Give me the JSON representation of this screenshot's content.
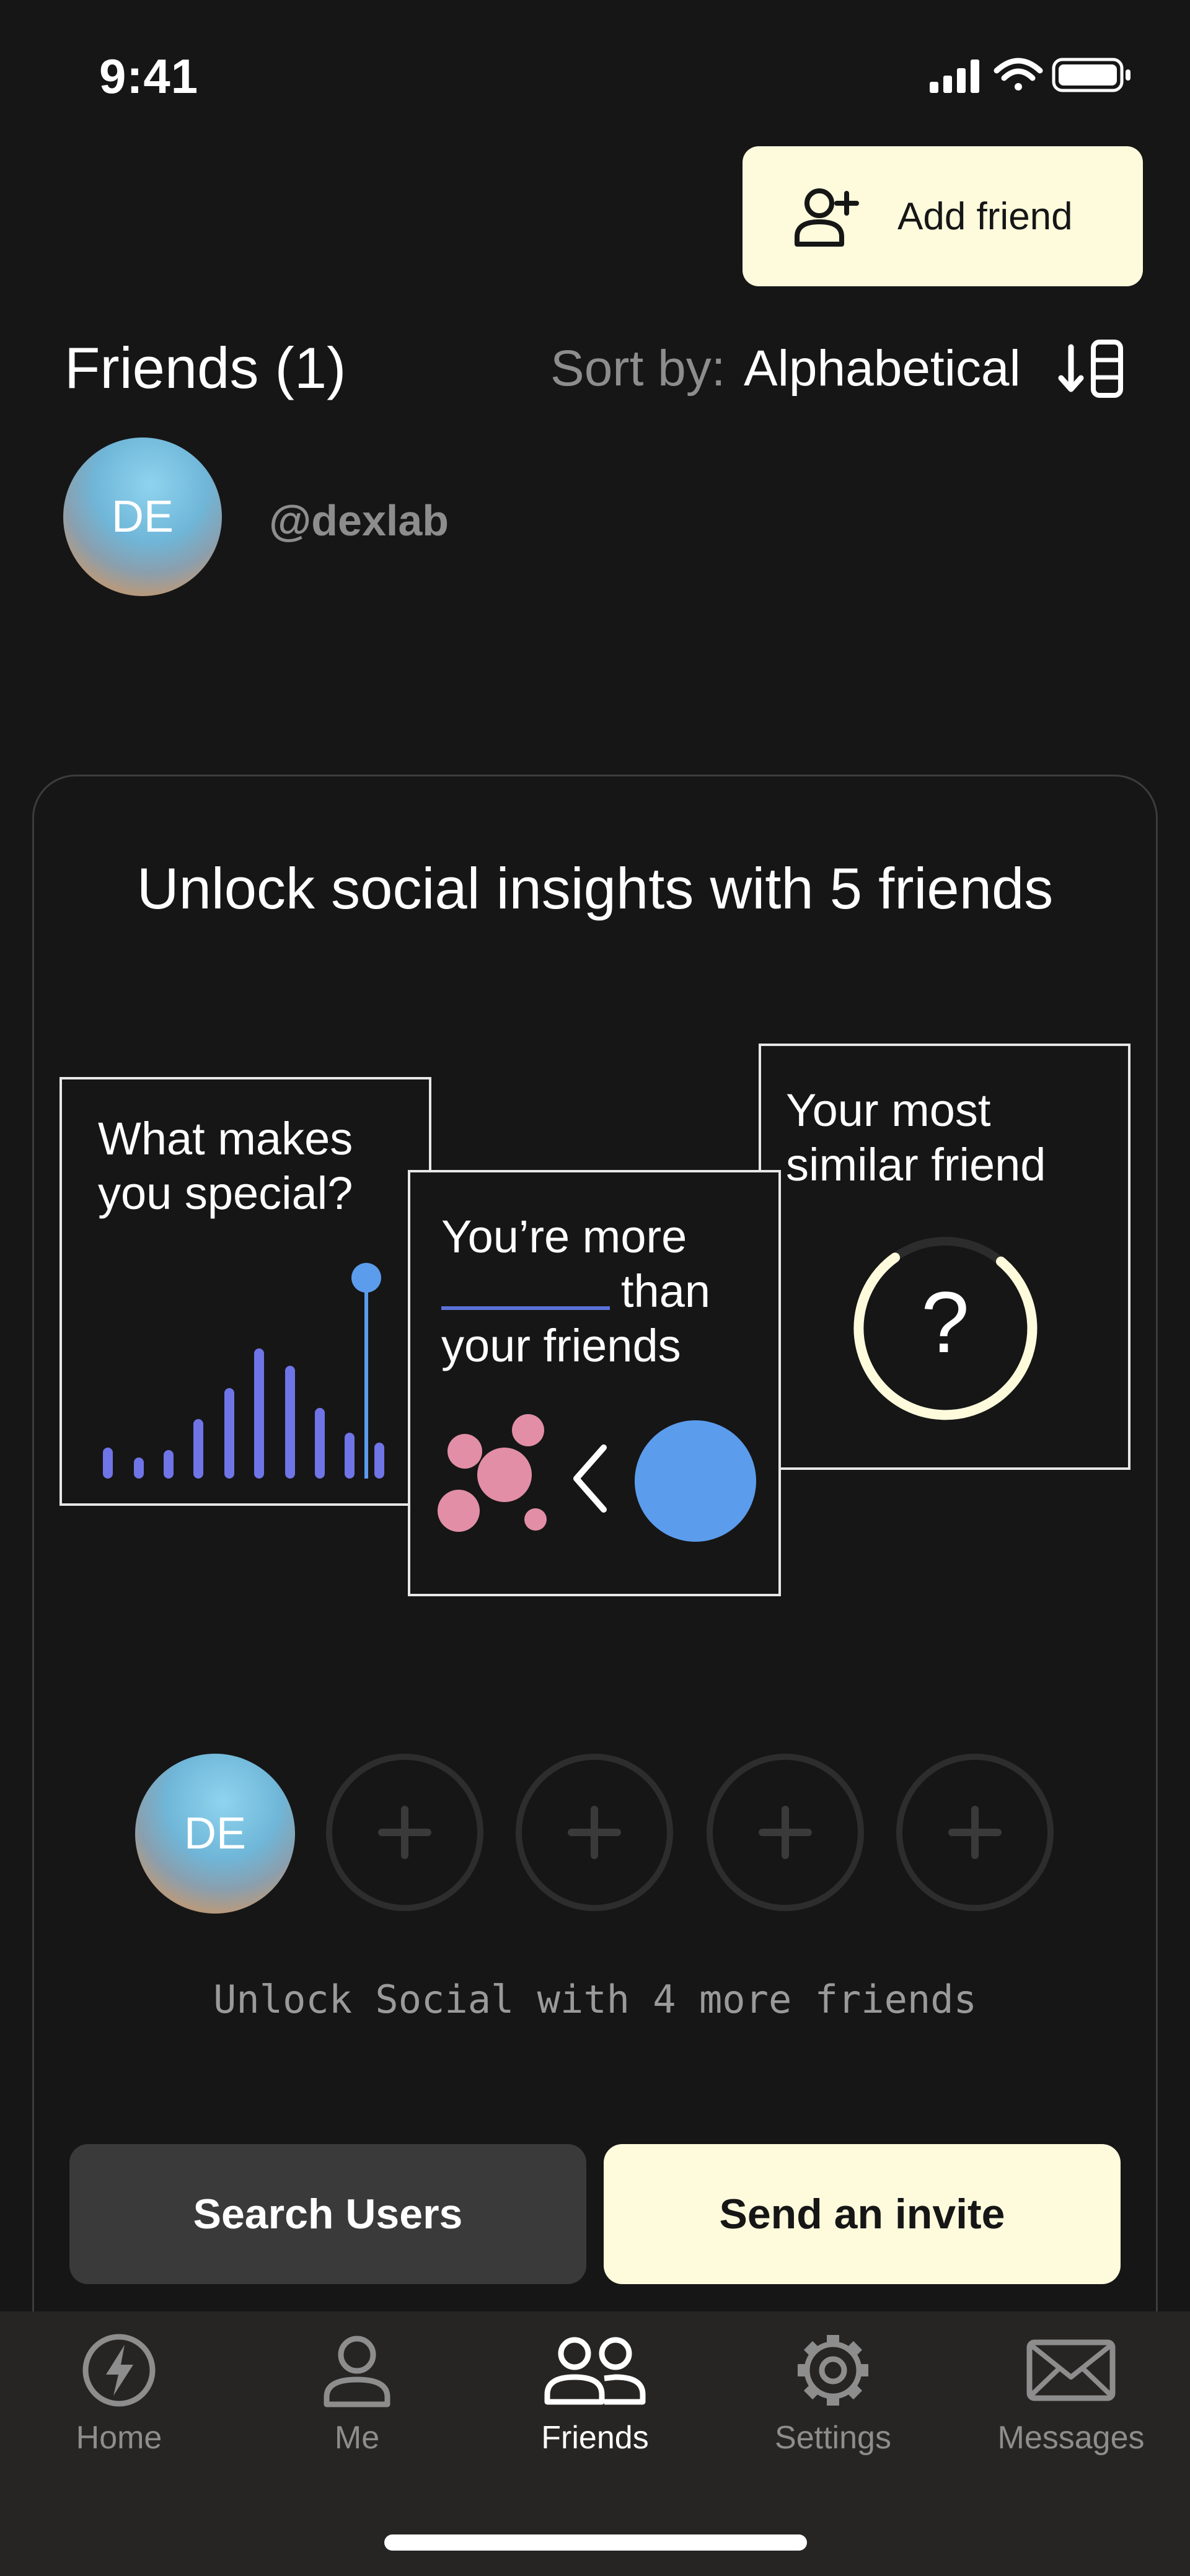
{
  "status_bar": {
    "time": "9:41"
  },
  "header": {
    "add_friend_label": "Add friend"
  },
  "friends": {
    "title": "Friends (1)",
    "sort_label": "Sort by:",
    "sort_value": "Alphabetical",
    "list": [
      {
        "initials": "DE",
        "handle": "@dexlab"
      }
    ]
  },
  "insights": {
    "title": "Unlock social insights with 5 friends",
    "tile_special": {
      "line1": "What makes",
      "line2": "you special?"
    },
    "tile_more": {
      "line1": "You’re more",
      "line2": "than",
      "line3": "your friends"
    },
    "tile_similar": {
      "line1": "Your most",
      "line2": "similar friend",
      "mystery": "?"
    },
    "slots": [
      {
        "filled": true,
        "initials": "DE"
      },
      {
        "filled": false
      },
      {
        "filled": false
      },
      {
        "filled": false
      },
      {
        "filled": false
      }
    ],
    "unlock_text": "Unlock Social with 4 more friends",
    "search_button": "Search Users",
    "invite_button": "Send an invite"
  },
  "colors": {
    "background": "#161616",
    "accent_cream": "#fdfbdc",
    "bar_purple": "#6f74e6",
    "blue": "#5b9cec",
    "pink": "#e28ea6"
  },
  "tabs": [
    {
      "label": "Home",
      "icon": "bolt-icon",
      "active": false
    },
    {
      "label": "Me",
      "icon": "person-icon",
      "active": false
    },
    {
      "label": "Friends",
      "icon": "friends-icon",
      "active": true
    },
    {
      "label": "Settings",
      "icon": "gear-icon",
      "active": false
    },
    {
      "label": "Messages",
      "icon": "envelope-icon",
      "active": false
    }
  ]
}
